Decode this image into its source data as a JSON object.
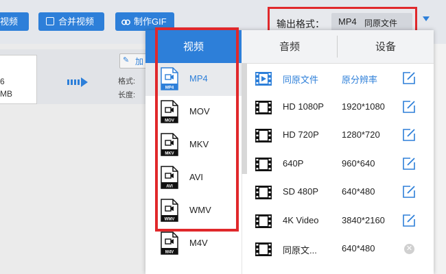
{
  "toolbar": {
    "buttons": [
      {
        "label": "视频"
      },
      {
        "label": "合并视频"
      },
      {
        "label": "制作GIF"
      }
    ],
    "output_format_label": "输出格式：",
    "output_format_value": "MP4",
    "output_format_sub": "同原文件"
  },
  "file": {
    "line1": "6",
    "line2": "MB",
    "format_label": "格式:",
    "length_label": "长度:",
    "add_label": "加"
  },
  "panel": {
    "tabs": [
      "视频",
      "音频",
      "设备"
    ],
    "active_tab": "视频",
    "formats": [
      {
        "name": "MP4",
        "tag": "MP4"
      },
      {
        "name": "MOV",
        "tag": "MOV"
      },
      {
        "name": "MKV",
        "tag": "MKV"
      },
      {
        "name": "AVI",
        "tag": "AVI"
      },
      {
        "name": "WMV",
        "tag": "WMV"
      },
      {
        "name": "M4V",
        "tag": "M4V"
      }
    ],
    "presets": [
      {
        "name": "同原文件",
        "res": "原分辨率"
      },
      {
        "name": "HD 1080P",
        "res": "1920*1080"
      },
      {
        "name": "HD 720P",
        "res": "1280*720"
      },
      {
        "name": "640P",
        "res": "960*640"
      },
      {
        "name": "SD 480P",
        "res": "640*480"
      },
      {
        "name": "4K Video",
        "res": "3840*2160"
      },
      {
        "name": "同原文...",
        "res": "640*480"
      }
    ]
  },
  "colors": {
    "accent": "#2d7fd9",
    "highlight_border": "#e0282b"
  }
}
